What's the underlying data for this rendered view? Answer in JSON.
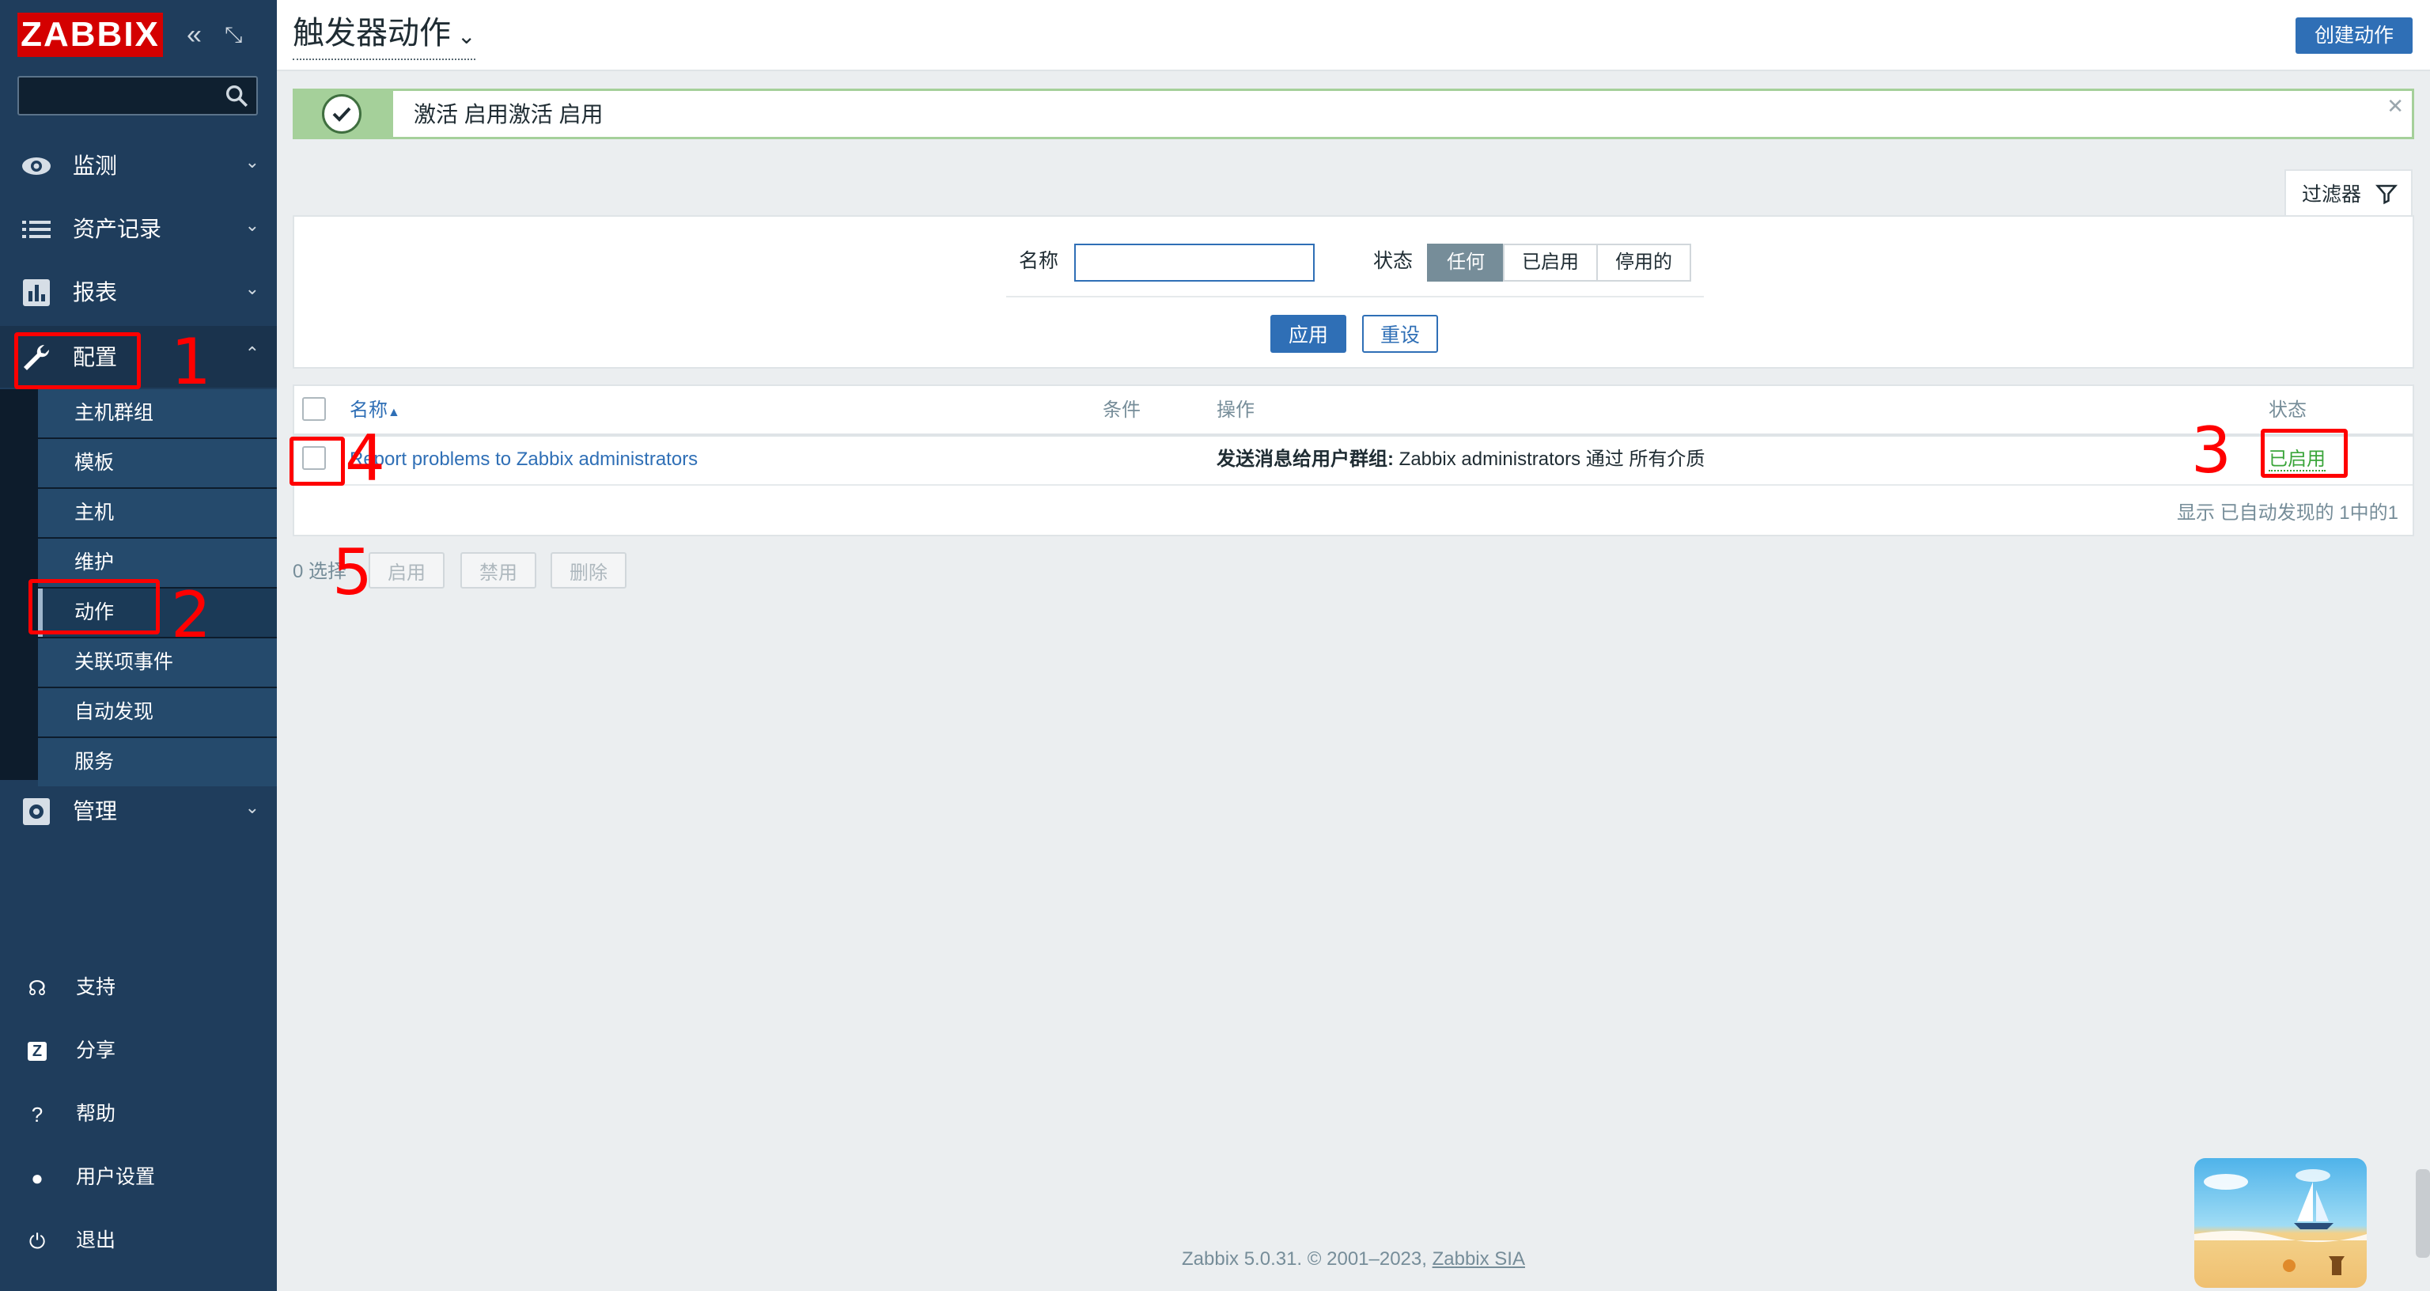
{
  "app": {
    "logo": "ZABBIX"
  },
  "sidebar": {
    "menu": [
      {
        "label": "监测"
      },
      {
        "label": "资产记录"
      },
      {
        "label": "报表"
      },
      {
        "label": "配置"
      },
      {
        "label": "管理"
      }
    ],
    "config_submenu": [
      "主机群组",
      "模板",
      "主机",
      "维护",
      "动作",
      "关联项事件",
      "自动发现",
      "服务"
    ],
    "bottom": [
      {
        "label": "支持",
        "icon": "headset-icon"
      },
      {
        "label": "分享",
        "icon": "share-icon"
      },
      {
        "label": "帮助",
        "icon": "help-icon"
      },
      {
        "label": "用户设置",
        "icon": "user-icon"
      },
      {
        "label": "退出",
        "icon": "power-icon"
      }
    ]
  },
  "header": {
    "title": "触发器动作",
    "create_button": "创建动作"
  },
  "message": {
    "text": "激活 启用激活 启用"
  },
  "filter": {
    "tab_label": "过滤器",
    "name_label": "名称",
    "name_value": "",
    "status_label": "状态",
    "status_options": [
      "任何",
      "已启用",
      "停用的"
    ],
    "status_selected": "任何",
    "apply": "应用",
    "reset": "重设"
  },
  "table": {
    "columns": {
      "name": "名称",
      "sort_mark": "▲",
      "conditions": "条件",
      "operations": "操作",
      "status": "状态"
    },
    "rows": [
      {
        "name": "Report problems to Zabbix administrators",
        "conditions": "",
        "operation_bold": "发送消息给用户群组:",
        "operation_rest": " Zabbix administrators 通过 所有介质",
        "status": "已启用"
      }
    ],
    "count_text": "显示 已自动发现的 1中的1"
  },
  "mass_actions": {
    "selected": "0 选择",
    "enable": "启用",
    "disable": "禁用",
    "delete": "删除"
  },
  "annotations": [
    "1",
    "2",
    "3",
    "4",
    "5"
  ],
  "footer": {
    "text": "Zabbix 5.0.31. © 2001–2023, ",
    "company": "Zabbix SIA"
  },
  "colors": {
    "sidebar": "#1f3d5c",
    "accent": "#2f6fb6",
    "logo": "#d40000",
    "success": "#a5d09a",
    "enabled": "#3aa53a",
    "annotation": "#ff0000"
  }
}
